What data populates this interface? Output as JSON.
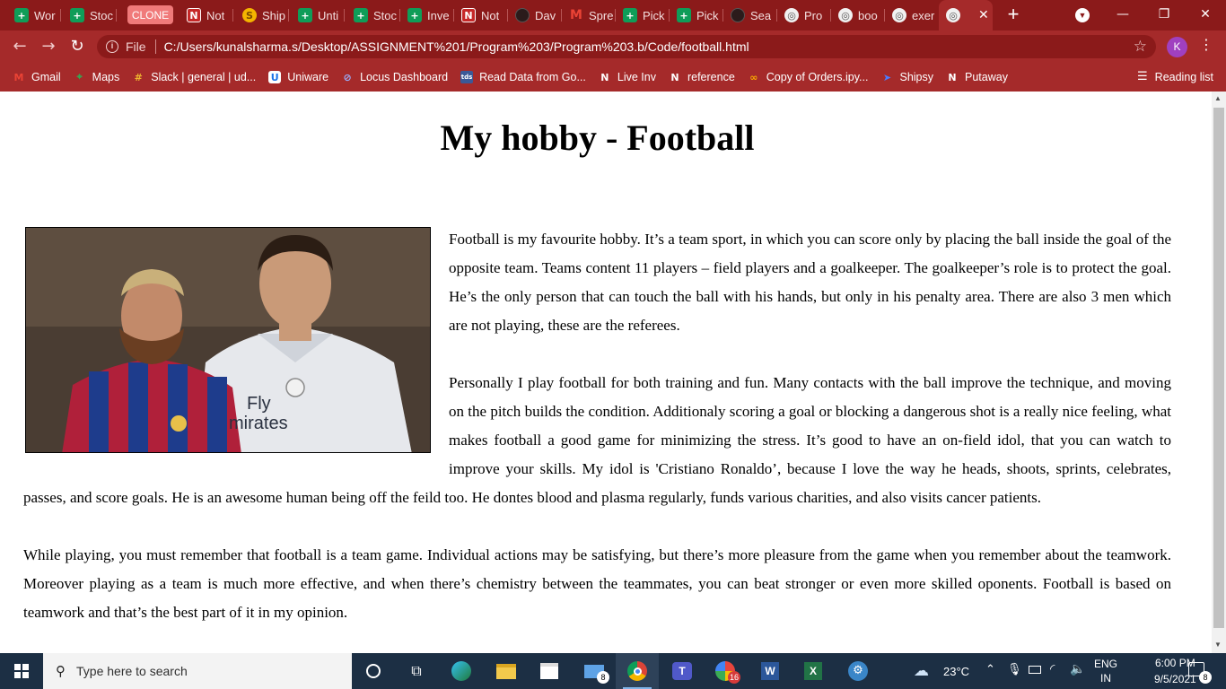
{
  "browser": {
    "clone_chip_label": "CLONE",
    "tabs": [
      {
        "title": "Wor",
        "icon": "google-sheets-icon"
      },
      {
        "title": "Stoc",
        "icon": "google-sheets-icon"
      },
      {
        "title": "Not",
        "icon": "notion-icon"
      },
      {
        "title": "Ship",
        "icon": "shipsy-icon"
      },
      {
        "title": "Unti",
        "icon": "google-sheets-icon"
      },
      {
        "title": "Stoc",
        "icon": "google-sheets-icon"
      },
      {
        "title": "Inve",
        "icon": "google-sheets-icon"
      },
      {
        "title": "Not",
        "icon": "notion-icon"
      },
      {
        "title": "Dav",
        "icon": "github-icon"
      },
      {
        "title": "Spre",
        "icon": "gmail-icon"
      },
      {
        "title": "Pick",
        "icon": "google-sheets-icon"
      },
      {
        "title": "Pick",
        "icon": "google-sheets-icon"
      },
      {
        "title": "Sea",
        "icon": "github-icon"
      },
      {
        "title": "Pro",
        "icon": "globe-icon"
      },
      {
        "title": "boo",
        "icon": "globe-icon"
      },
      {
        "title": "exer",
        "icon": "globe-icon"
      },
      {
        "title": "",
        "icon": "globe-icon"
      }
    ],
    "omnibox": {
      "file_label": "File",
      "url": "C:/Users/kunalsharma.s/Desktop/ASSIGNMENT%201/Program%203/Program%203.b/Code/football.html"
    },
    "profile_initial": "K",
    "bookmarks": [
      {
        "label": "Gmail",
        "icon": "gmail-icon"
      },
      {
        "label": "Maps",
        "icon": "maps-icon"
      },
      {
        "label": "Slack | general | ud...",
        "icon": "slack-icon"
      },
      {
        "label": "Uniware",
        "icon": "uniware-icon"
      },
      {
        "label": "Locus Dashboard",
        "icon": "locus-icon"
      },
      {
        "label": "Read Data from Go...",
        "icon": "tds-icon"
      },
      {
        "label": "Live Inv",
        "icon": "notion-icon"
      },
      {
        "label": "reference",
        "icon": "notion-icon"
      },
      {
        "label": "Copy of Orders.ipy...",
        "icon": "colab-icon"
      },
      {
        "label": "Shipsy",
        "icon": "shipsy-arrow-icon"
      },
      {
        "label": "Putaway",
        "icon": "notion-icon"
      }
    ],
    "reading_list_label": "Reading list"
  },
  "page": {
    "heading": "My hobby - Football",
    "paragraphs": [
      "Football is my favourite hobby. It’s a team sport, in which you can score only by placing the ball inside the goal of the opposite team. Teams content 11 players – field players and a goalkeeper. The goalkeeper’s role is to protect the goal. He’s the only person that can touch the ball with his hands, but only in his penalty area. There are also 3 men which are not playing, these are the referees.",
      "Personally I play football for both training and fun. Many contacts with the ball improve the technique, and moving on the pitch builds the condition. Additionaly scoring a goal or blocking a dangerous shot is a really nice feeling, what makes football a good game for minimizing the stress. It’s good to have an on-field idol, that you can watch to improve your skills. My idol is 'Cristiano Ronaldo’, because I love the way he heads, shoots, sprints, celebrates, passes, and score goals. He is an awesome human being off the feild too. He dontes blood and plasma regularly, funds various charities, and also visits cancer patients.",
      "While playing, you must remember that football is a team game. Individual actions may be satisfying, but there’s more pleasure from the game when you remember about the teamwork. Moreover playing as a team is much more effective, and when there’s chemistry between the teammates, you can beat stronger or even more skilled oponents. Football is based on teamwork and that’s the best part of it in my opinion."
    ],
    "photo_jersey_text": "Fly\nmirates"
  },
  "taskbar": {
    "search_placeholder": "Type here to search",
    "mail_badge": "8",
    "chat_badge": "16",
    "weather_temp": "23°C",
    "language_line1": "ENG",
    "language_line2": "IN",
    "time": "6:00 PM",
    "date": "9/5/2021",
    "notification_badge": "8"
  },
  "colors": {
    "tabstrip": "#8b1a1a",
    "toolbar": "#a52a2a",
    "taskbar": "#1c2f44"
  }
}
